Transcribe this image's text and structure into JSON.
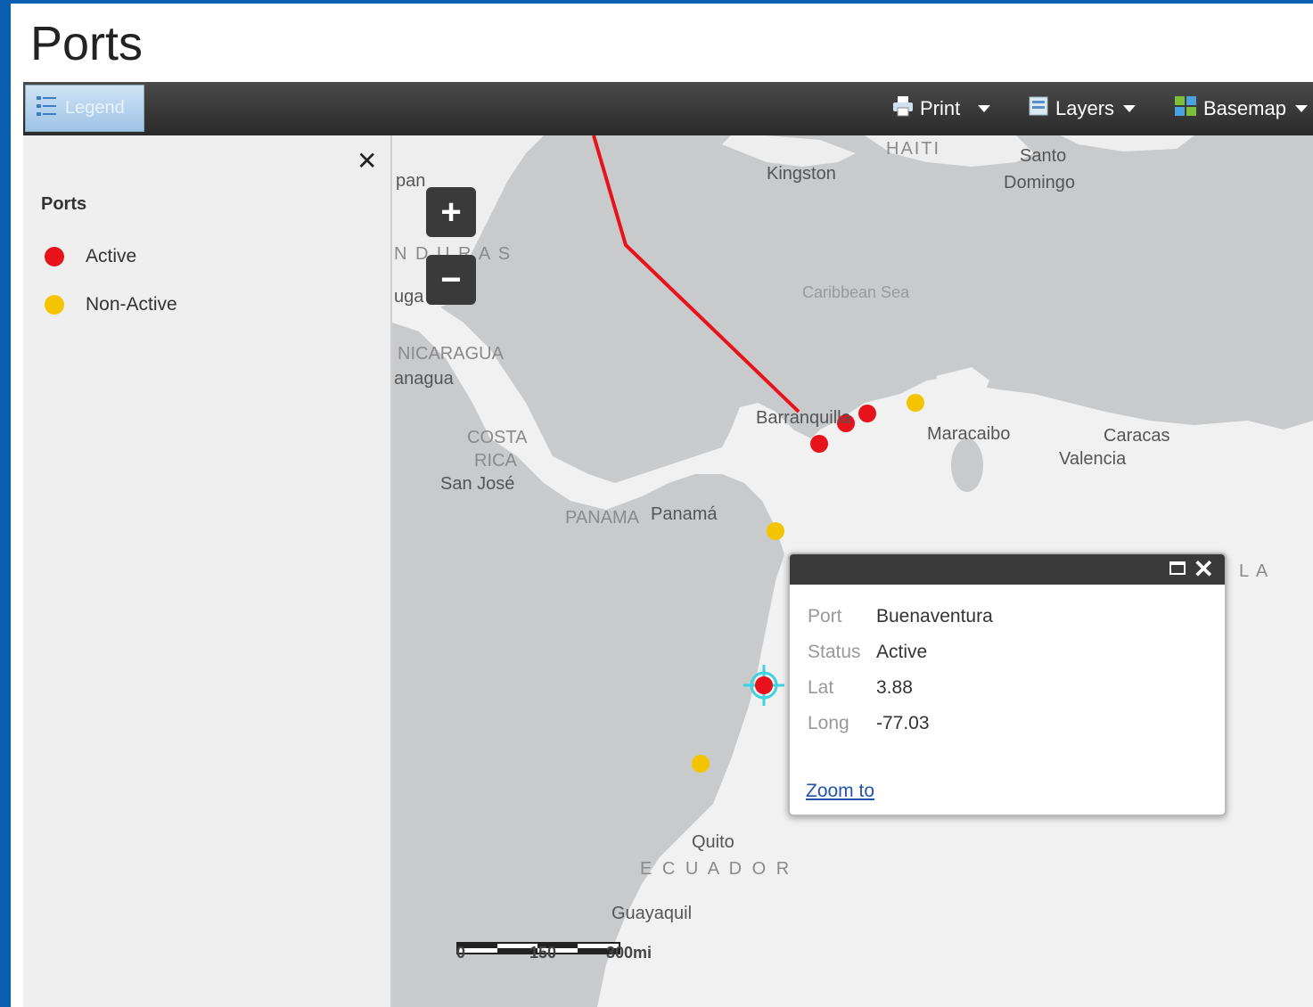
{
  "page": {
    "title": "Ports"
  },
  "toolbar": {
    "legend_label": "Legend",
    "print_label": "Print",
    "layers_label": "Layers",
    "basemap_label": "Basemap"
  },
  "legend": {
    "layer_title": "Ports",
    "items": [
      {
        "label": "Active",
        "color": "#e8121a"
      },
      {
        "label": "Non-Active",
        "color": "#f5c400"
      }
    ]
  },
  "map": {
    "zoom_in": "+",
    "zoom_out": "−",
    "labels": {
      "kingston": "Kingston",
      "haiti": "HAITI",
      "santo": "Santo",
      "domingo": "Domingo",
      "caribbean_sea": "Caribbean Sea",
      "honduras": "N D U R A S",
      "pan": "pan",
      "uga": "uga",
      "nicaragua": "NICARAGUA",
      "managua": "anagua",
      "costa": "COSTA",
      "rica": "RICA",
      "san_jose": "San José",
      "panama_country": "PANAMA",
      "panama_city": "Panamá",
      "barranquilla": "Barranquilla",
      "maracaibo": "Maracaibo",
      "caracas": "Caracas",
      "valencia": "Valencia",
      "quito": "Quito",
      "ecuador": "E C U A D O R",
      "guayaquil": "Guayaquil",
      "venezuela_partial": "L  A"
    },
    "scale": {
      "labels": [
        "0",
        "150",
        "300mi"
      ]
    },
    "colors": {
      "land": "#f0f0f0",
      "water": "#c9cacc",
      "route": "#e8121a"
    }
  },
  "popup": {
    "fields": [
      {
        "key": "Port",
        "value": "Buenaventura"
      },
      {
        "key": "Status",
        "value": "Active"
      },
      {
        "key": "Lat",
        "value": "3.88"
      },
      {
        "key": "Long",
        "value": "-77.03"
      }
    ],
    "zoom_link": "Zoom to"
  }
}
